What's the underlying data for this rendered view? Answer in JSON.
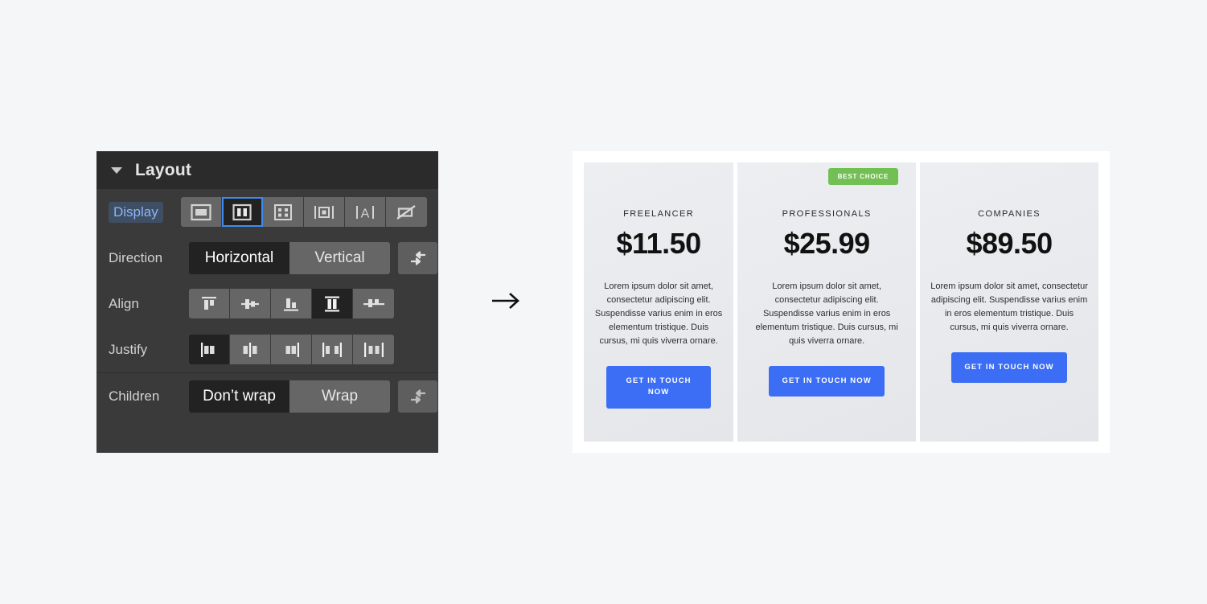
{
  "panel": {
    "title": "Layout",
    "caret_icon": "caret-down-icon",
    "rows": {
      "display": {
        "label": "Display",
        "options": [
          {
            "name": "block",
            "icon": "display-block-icon",
            "selected": false
          },
          {
            "name": "flex",
            "icon": "display-flex-icon",
            "selected": true
          },
          {
            "name": "grid",
            "icon": "display-grid-icon",
            "selected": false
          },
          {
            "name": "inline-block",
            "icon": "display-inline-block-icon",
            "selected": false
          },
          {
            "name": "inline",
            "icon": "display-inline-icon",
            "selected": false
          },
          {
            "name": "none",
            "icon": "display-none-icon",
            "selected": false
          }
        ]
      },
      "direction": {
        "label": "Direction",
        "options": [
          {
            "name": "horizontal",
            "label": "Horizontal",
            "selected": true
          },
          {
            "name": "vertical",
            "label": "Vertical",
            "selected": false
          }
        ],
        "aux_icon": "reverse-direction-icon"
      },
      "align": {
        "label": "Align",
        "options": [
          {
            "name": "align-start",
            "icon": "align-start-icon",
            "selected": false
          },
          {
            "name": "align-center",
            "icon": "align-center-icon",
            "selected": false
          },
          {
            "name": "align-end",
            "icon": "align-end-icon",
            "selected": false
          },
          {
            "name": "align-stretch",
            "icon": "align-stretch-icon",
            "selected": true
          },
          {
            "name": "align-baseline",
            "icon": "align-baseline-icon",
            "selected": false
          }
        ]
      },
      "justify": {
        "label": "Justify",
        "options": [
          {
            "name": "justify-start",
            "icon": "justify-start-icon",
            "selected": true
          },
          {
            "name": "justify-center",
            "icon": "justify-center-icon",
            "selected": false
          },
          {
            "name": "justify-end",
            "icon": "justify-end-icon",
            "selected": false
          },
          {
            "name": "justify-space-between",
            "icon": "justify-space-between-icon",
            "selected": false
          },
          {
            "name": "justify-space-around",
            "icon": "justify-space-around-icon",
            "selected": false
          }
        ]
      },
      "children": {
        "label": "Children",
        "options": [
          {
            "name": "dont-wrap",
            "label": "Don’t wrap",
            "selected": true
          },
          {
            "name": "wrap",
            "label": "Wrap",
            "selected": false
          }
        ],
        "aux_icon": "reverse-wrap-icon"
      }
    }
  },
  "flow": {
    "arrow_icon": "arrow-right-icon"
  },
  "preview": {
    "cards": [
      {
        "name": "FREELANCER",
        "price": "$11.50",
        "description": "Lorem ipsum dolor sit amet, consectetur adipiscing elit. Suspendisse varius enim in eros elementum tristique. Duis cursus, mi quis viverra ornare.",
        "cta": "GET IN TOUCH NOW",
        "badge": null
      },
      {
        "name": "PROFESSIONALS",
        "price": "$25.99",
        "description": "Lorem ipsum dolor sit amet, consectetur adipiscing elit. Suspendisse varius enim in eros elementum tristique. Duis cursus, mi quis viverra ornare.",
        "cta": "GET IN TOUCH NOW",
        "badge": "BEST CHOICE"
      },
      {
        "name": "COMPANIES",
        "price": "$89.50",
        "description": "Lorem ipsum dolor sit amet, consectetur adipiscing elit. Suspendisse varius enim in eros elementum tristique. Duis cursus, mi quis viverra ornare.",
        "cta": "GET IN TOUCH NOW",
        "badge": null
      }
    ]
  },
  "colors": {
    "accent_blue": "#3d8bf2",
    "cta_blue": "#3b6ef5",
    "badge_green": "#72bf54",
    "panel_bg": "#3a3a3a",
    "panel_header_bg": "#2b2b2b",
    "selected_bg": "#222222",
    "page_bg": "#f5f6f8"
  }
}
